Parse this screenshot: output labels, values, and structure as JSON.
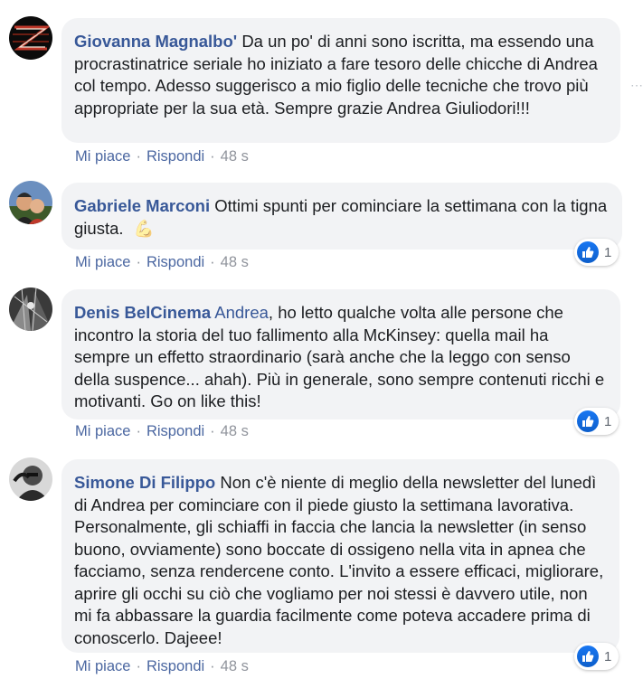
{
  "comments": [
    {
      "author": "Giovanna Magnalbo'",
      "mention": "",
      "text": "Da un po' di anni sono iscritta, ma essendo una procrastinatrice seriale ho iniziato a fare tesoro delle chicche di Andrea col tempo. Adesso suggerisco a mio figlio delle tecniche che trovo più appropriate per la sua età. Sempre grazie Andrea Giuliodori!!!",
      "like_label": "Mi piace",
      "reply_label": "Rispondi",
      "time": "48 s",
      "reactions": ""
    },
    {
      "author": "Gabriele Marconi",
      "mention": "",
      "text": "Ottimi spunti per cominciare la settimana con la tigna giusta.",
      "emoji": "💪",
      "like_label": "Mi piace",
      "reply_label": "Rispondi",
      "time": "48 s",
      "reactions": "1"
    },
    {
      "author": "Denis BelCinema",
      "mention": "Andrea",
      "text": ", ho letto qualche volta alle persone che incontro la storia del tuo fallimento alla McKinsey: quella mail ha sempre un effetto straordinario (sarà anche che la leggo con senso della suspence... ahah). Più in generale, sono sempre contenuti ricchi e motivanti. Go on like this!",
      "like_label": "Mi piace",
      "reply_label": "Rispondi",
      "time": "48 s",
      "reactions": "1"
    },
    {
      "author": "Simone Di Filippo",
      "mention": "",
      "text": "Non c'è niente di meglio della newsletter del lunedì di Andrea per cominciare con il piede giusto la settimana lavorativa. Personalmente, gli schiaffi in faccia che lancia la newsletter (in senso buono, ovviamente) sono boccate di ossigeno nella vita in apnea che facciamo, senza rendercene conto. L'invito a essere efficaci, migliorare, aprire gli occhi su ciò che vogliamo per noi stessi è davvero utile, non mi fa abbassare la guardia facilmente come poteva accadere prima di conoscerlo. Dajeee!",
      "like_label": "Mi piace",
      "reply_label": "Rispondi",
      "time": "48 s",
      "reactions": "1"
    }
  ],
  "separator": "·",
  "colors": {
    "author_link": "#385898",
    "bubble_bg": "#f2f3f5",
    "meta_gray": "#90949c",
    "like_blue": "#1877f2"
  }
}
